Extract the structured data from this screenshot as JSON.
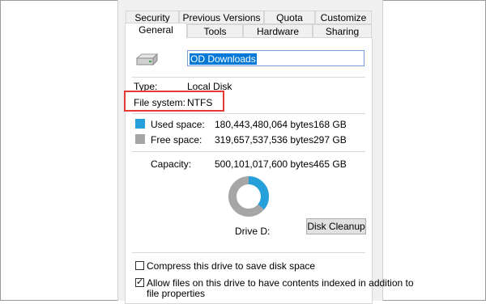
{
  "dialog": {
    "tabs_row1": [
      "Security",
      "Previous Versions",
      "Quota",
      "Customize"
    ],
    "tabs_row2": [
      "General",
      "Tools",
      "Hardware",
      "Sharing"
    ],
    "active_tab": "General"
  },
  "general": {
    "drive_name": "OD Downloads",
    "type_label": "Type:",
    "type_value": "Local Disk",
    "fs_label": "File system:",
    "fs_value": "NTFS",
    "used_label": "Used space:",
    "used_bytes": "180,443,480,064 bytes",
    "used_gb": "168 GB",
    "free_label": "Free space:",
    "free_bytes": "319,657,537,536 bytes",
    "free_gb": "297 GB",
    "capacity_label": "Capacity:",
    "capacity_bytes": "500,101,017,600 bytes",
    "capacity_gb": "465 GB",
    "drive_label": "Drive D:",
    "cleanup_button": "Disk Cleanup",
    "compress_label": "Compress this drive to save disk space",
    "compress_checked": false,
    "index_label_line1": "Allow files on this drive to have contents indexed in addition to",
    "index_label_line2": "file properties",
    "index_checked": true
  },
  "colors": {
    "used": "#26a0da",
    "free": "#a6a6a6",
    "highlight": "#e53935"
  },
  "usage": {
    "used_fraction": 0.361
  }
}
